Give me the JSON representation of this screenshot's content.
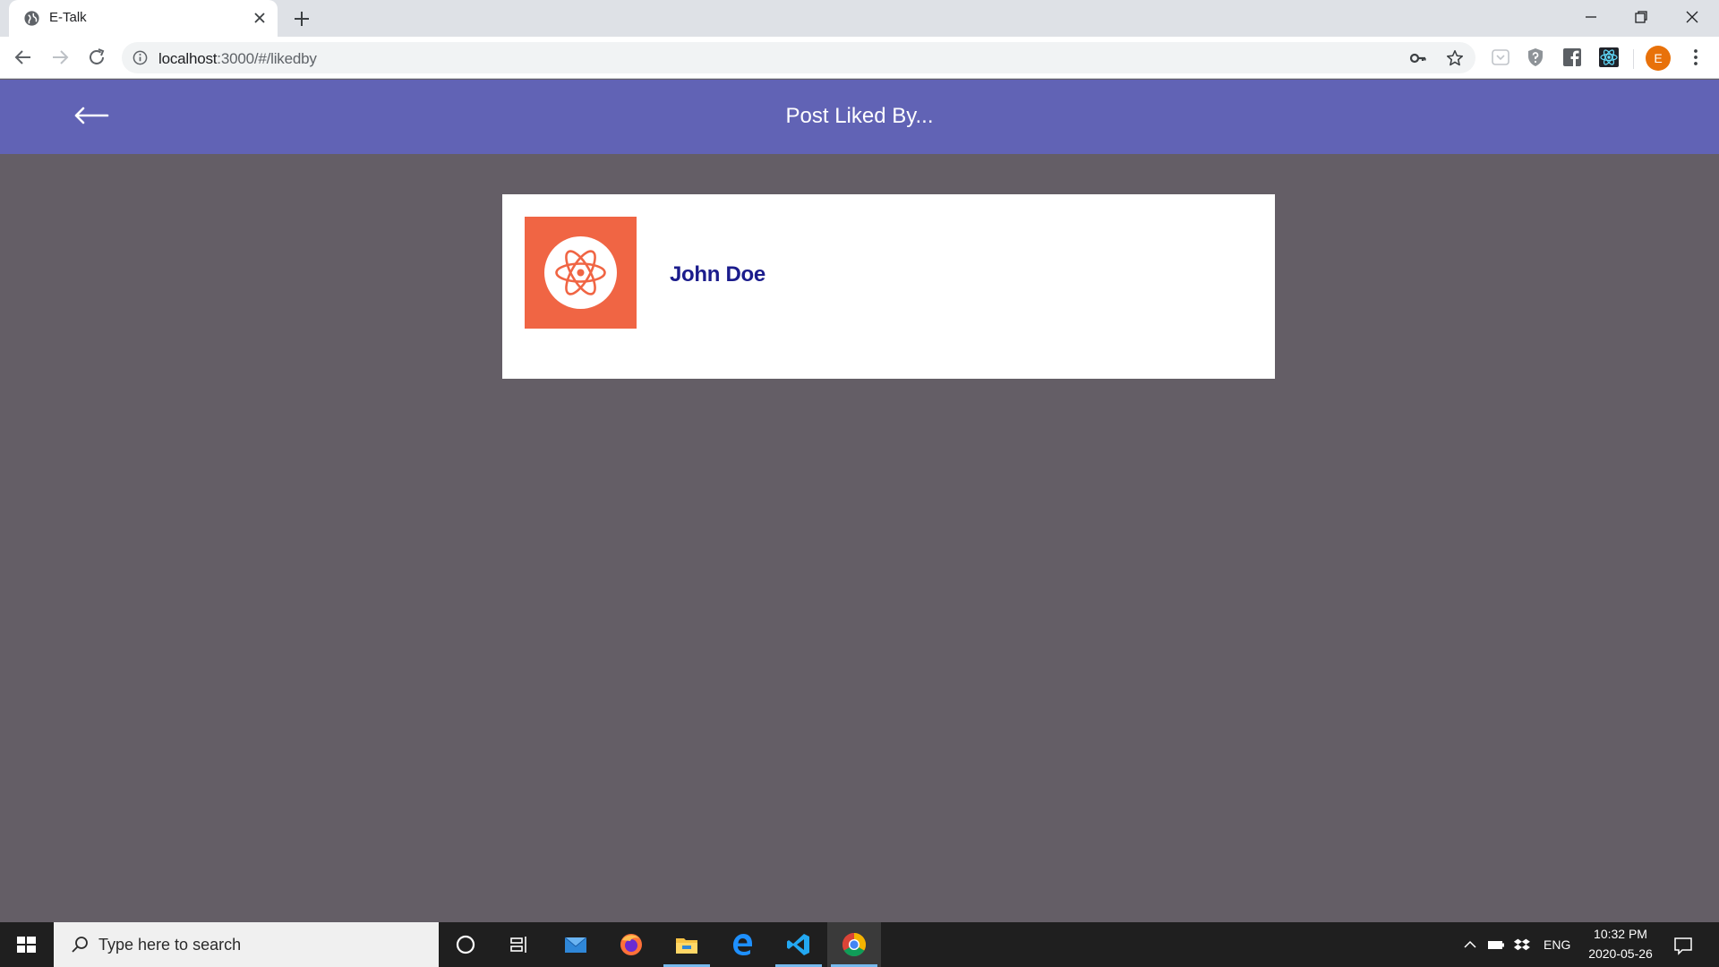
{
  "browser": {
    "tab_title": "E-Talk",
    "url_host": "localhost",
    "url_rest": ":3000/#/likedby"
  },
  "header": {
    "title": "Post Liked By..."
  },
  "likers": [
    {
      "name": "John Doe"
    }
  ],
  "profile": {
    "initial": "E"
  },
  "taskbar": {
    "search_placeholder": "Type here to search",
    "language": "ENG",
    "time": "10:32 PM",
    "date": "2020-05-26"
  },
  "colors": {
    "header_bg": "#6163b5",
    "page_bg": "#645e66",
    "avatar_bg": "#f06544",
    "name_color": "#1b1c8c"
  },
  "icons": {
    "avatar": "react-atom-icon",
    "back": "arrow-left-icon"
  }
}
